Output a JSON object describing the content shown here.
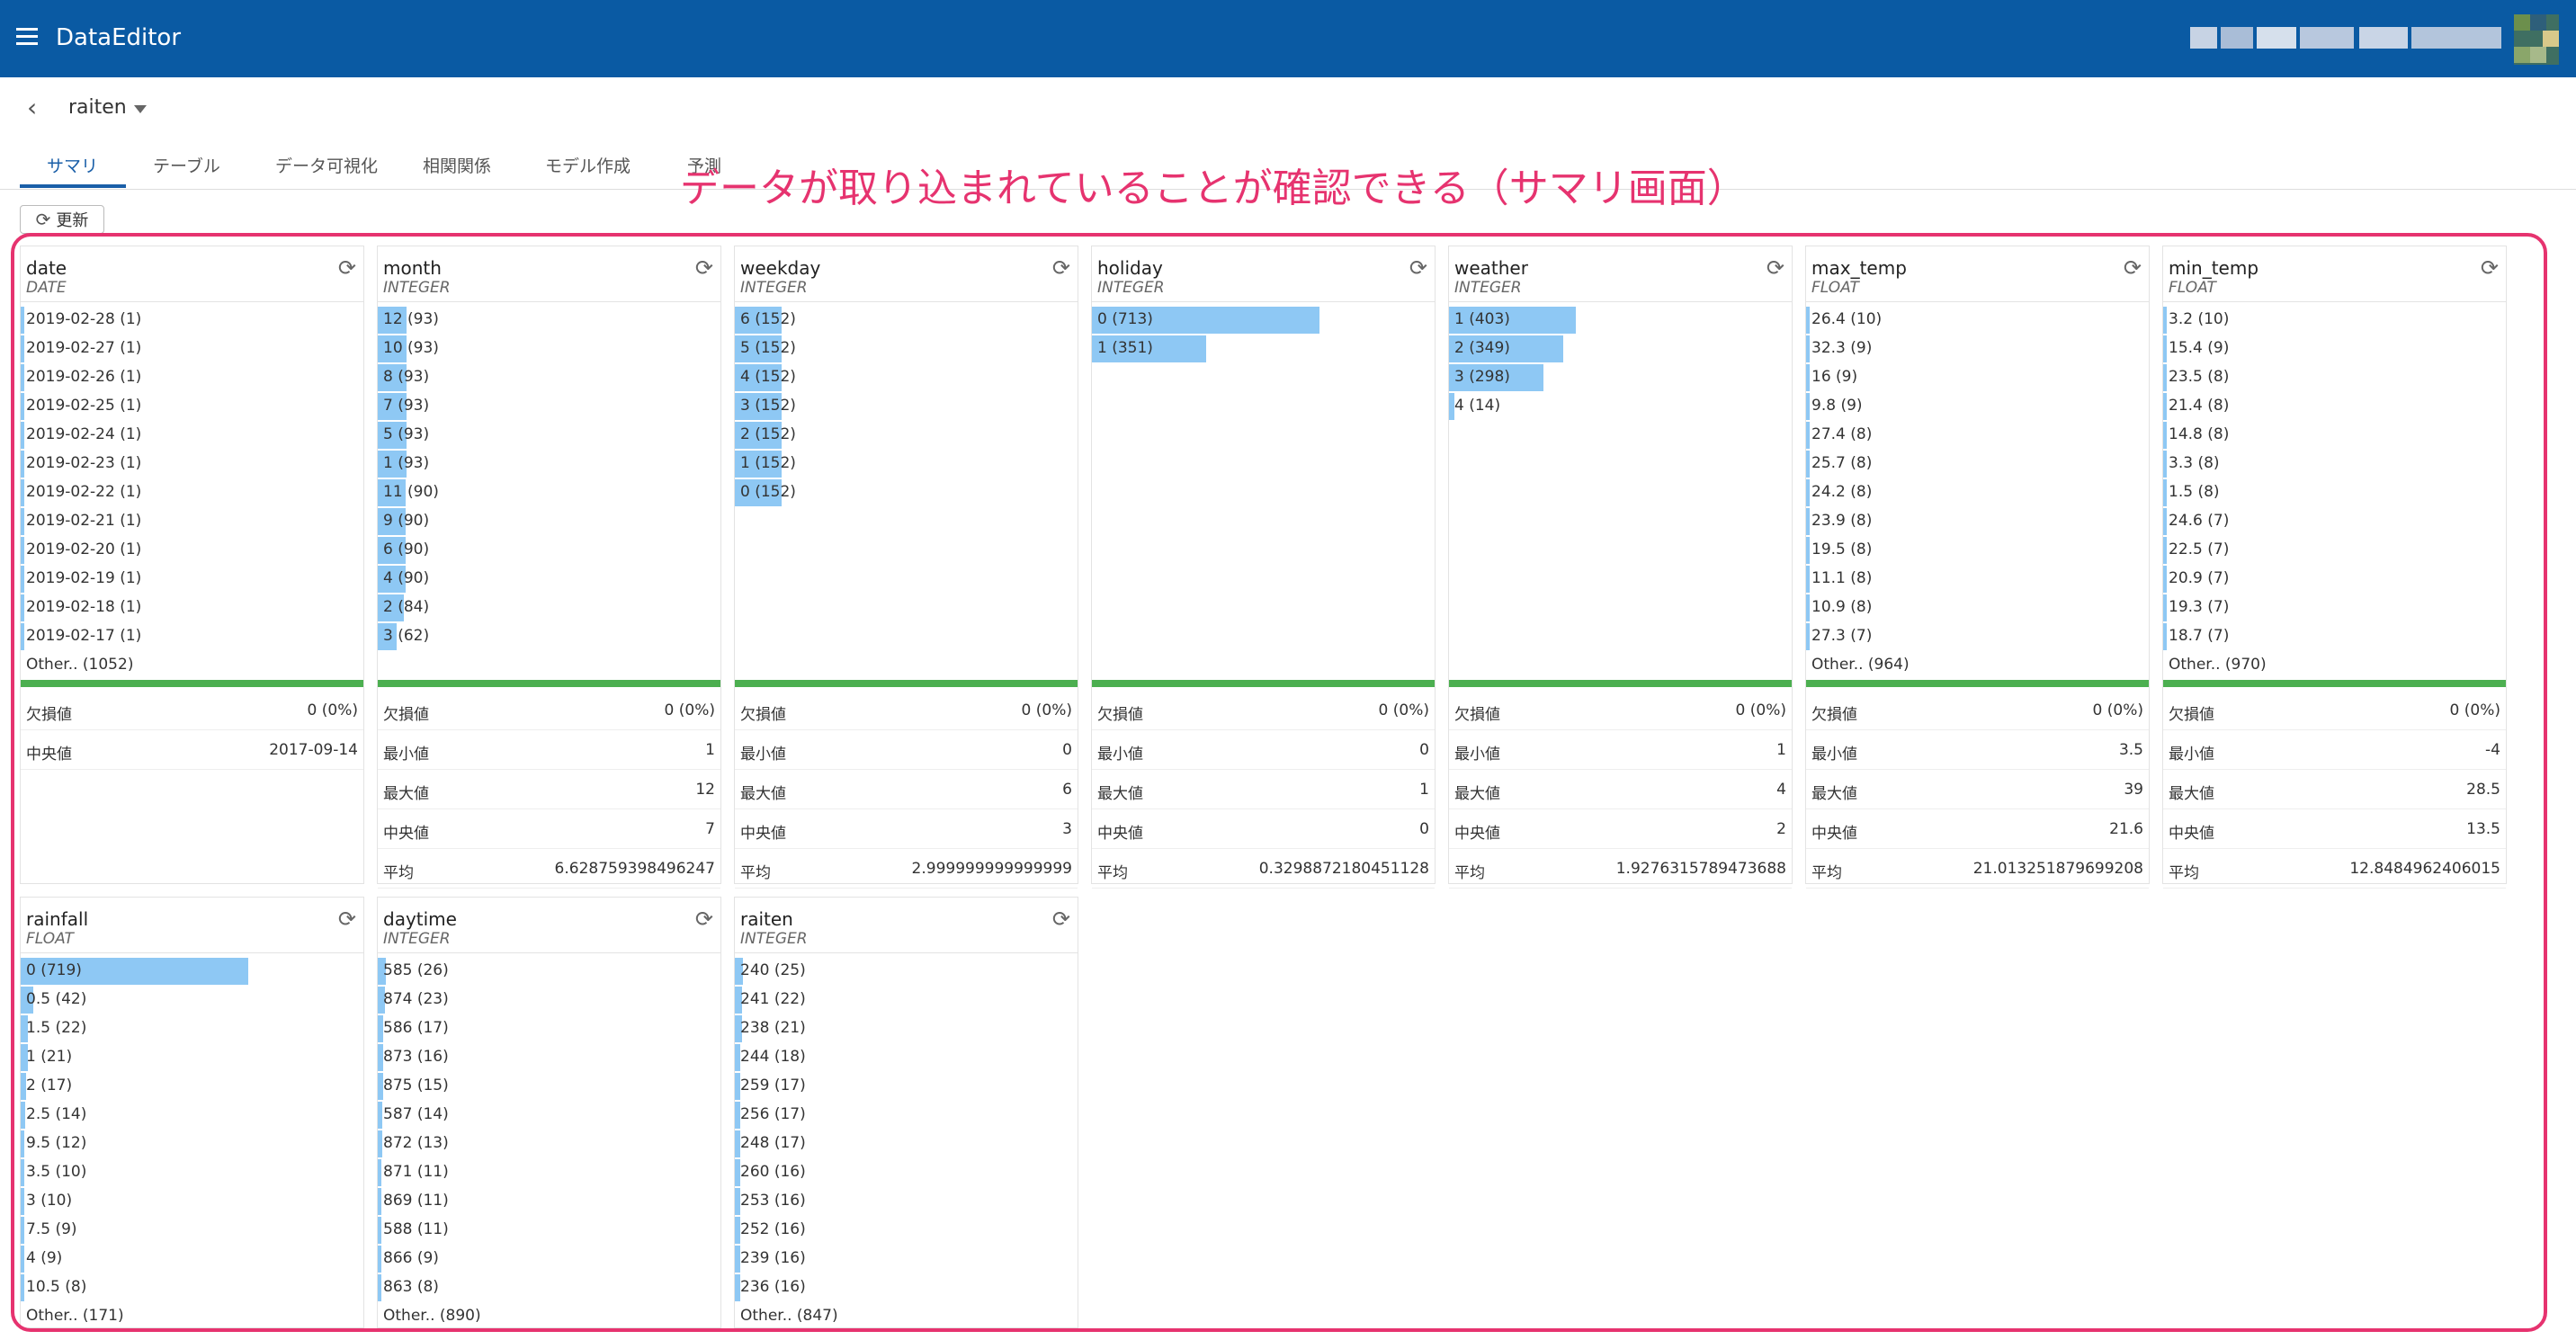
{
  "app": {
    "title": "DataEditor"
  },
  "breadcrumb": {
    "dataset": "raiten"
  },
  "tabs": [
    {
      "label": "サマリ",
      "active": true
    },
    {
      "label": "テーブル"
    },
    {
      "label": "データ可視化"
    },
    {
      "label": "相関関係"
    },
    {
      "label": "モデル作成"
    },
    {
      "label": "予測"
    }
  ],
  "toolbar": {
    "refresh_label": "更新"
  },
  "annotation": {
    "text": "データが取り込まれていることが確認できる（サマリ画面）"
  },
  "colors": {
    "header": "#0a5aa3",
    "bar": "#8ec8f4",
    "valid_line": "#4caf50",
    "annotation": "#e6336f"
  },
  "columns": [
    {
      "name": "date",
      "type": "DATE",
      "freq": [
        {
          "label": "2019-02-28 (1)",
          "ratio": 0.003
        },
        {
          "label": "2019-02-27 (1)",
          "ratio": 0.003
        },
        {
          "label": "2019-02-26 (1)",
          "ratio": 0.003
        },
        {
          "label": "2019-02-25 (1)",
          "ratio": 0.003
        },
        {
          "label": "2019-02-24 (1)",
          "ratio": 0.003
        },
        {
          "label": "2019-02-23 (1)",
          "ratio": 0.003
        },
        {
          "label": "2019-02-22 (1)",
          "ratio": 0.003
        },
        {
          "label": "2019-02-21 (1)",
          "ratio": 0.003
        },
        {
          "label": "2019-02-20 (1)",
          "ratio": 0.003
        },
        {
          "label": "2019-02-19 (1)",
          "ratio": 0.003
        },
        {
          "label": "2019-02-18 (1)",
          "ratio": 0.003
        },
        {
          "label": "2019-02-17 (1)",
          "ratio": 0.003
        }
      ],
      "other": "Other.. (1052)",
      "stats": [
        {
          "label": "欠損値",
          "value": "0 (0%)"
        },
        {
          "label": "中央値",
          "value": "2017-09-14"
        }
      ]
    },
    {
      "name": "month",
      "type": "INTEGER",
      "freq": [
        {
          "label": "12 (93)",
          "ratio": 0.045
        },
        {
          "label": "10 (93)",
          "ratio": 0.045
        },
        {
          "label": "8 (93)",
          "ratio": 0.045
        },
        {
          "label": "7 (93)",
          "ratio": 0.045
        },
        {
          "label": "5 (93)",
          "ratio": 0.045
        },
        {
          "label": "1 (93)",
          "ratio": 0.045
        },
        {
          "label": "11 (90)",
          "ratio": 0.044
        },
        {
          "label": "9 (90)",
          "ratio": 0.044
        },
        {
          "label": "6 (90)",
          "ratio": 0.044
        },
        {
          "label": "4 (90)",
          "ratio": 0.044
        },
        {
          "label": "2 (84)",
          "ratio": 0.041
        },
        {
          "label": "3 (62)",
          "ratio": 0.03
        }
      ],
      "other": "",
      "stats": [
        {
          "label": "欠損値",
          "value": "0 (0%)"
        },
        {
          "label": "最小値",
          "value": "1"
        },
        {
          "label": "最大値",
          "value": "12"
        },
        {
          "label": "中央値",
          "value": "7"
        },
        {
          "label": "平均",
          "value": "6.628759398496247"
        }
      ]
    },
    {
      "name": "weekday",
      "type": "INTEGER",
      "freq": [
        {
          "label": "6 (152)",
          "ratio": 0.074
        },
        {
          "label": "5 (152)",
          "ratio": 0.074
        },
        {
          "label": "4 (152)",
          "ratio": 0.074
        },
        {
          "label": "3 (152)",
          "ratio": 0.074
        },
        {
          "label": "2 (152)",
          "ratio": 0.074
        },
        {
          "label": "1 (152)",
          "ratio": 0.074
        },
        {
          "label": "0 (152)",
          "ratio": 0.074
        }
      ],
      "other": "",
      "stats": [
        {
          "label": "欠損値",
          "value": "0 (0%)"
        },
        {
          "label": "最小値",
          "value": "0"
        },
        {
          "label": "最大値",
          "value": "6"
        },
        {
          "label": "中央値",
          "value": "3"
        },
        {
          "label": "平均",
          "value": "2.999999999999999"
        }
      ]
    },
    {
      "name": "holiday",
      "type": "INTEGER",
      "freq": [
        {
          "label": "0 (713)",
          "ratio": 0.36
        },
        {
          "label": "1 (351)",
          "ratio": 0.18
        }
      ],
      "other": "",
      "stats": [
        {
          "label": "欠損値",
          "value": "0 (0%)"
        },
        {
          "label": "最小値",
          "value": "0"
        },
        {
          "label": "最大値",
          "value": "1"
        },
        {
          "label": "中央値",
          "value": "0"
        },
        {
          "label": "平均",
          "value": "0.3298872180451128"
        }
      ]
    },
    {
      "name": "weather",
      "type": "INTEGER",
      "freq": [
        {
          "label": "1 (403)",
          "ratio": 0.2
        },
        {
          "label": "2 (349)",
          "ratio": 0.18
        },
        {
          "label": "3 (298)",
          "ratio": 0.15
        },
        {
          "label": "4 (14)",
          "ratio": 0.008
        }
      ],
      "other": "",
      "stats": [
        {
          "label": "欠損値",
          "value": "0 (0%)"
        },
        {
          "label": "最小値",
          "value": "1"
        },
        {
          "label": "最大値",
          "value": "4"
        },
        {
          "label": "中央値",
          "value": "2"
        },
        {
          "label": "平均",
          "value": "1.9276315789473688"
        }
      ]
    },
    {
      "name": "max_temp",
      "type": "FLOAT",
      "freq": [
        {
          "label": "26.4 (10)",
          "ratio": 0.005
        },
        {
          "label": "32.3 (9)",
          "ratio": 0.005
        },
        {
          "label": "16 (9)",
          "ratio": 0.005
        },
        {
          "label": "9.8 (9)",
          "ratio": 0.005
        },
        {
          "label": "27.4 (8)",
          "ratio": 0.004
        },
        {
          "label": "25.7 (8)",
          "ratio": 0.004
        },
        {
          "label": "24.2 (8)",
          "ratio": 0.004
        },
        {
          "label": "23.9 (8)",
          "ratio": 0.004
        },
        {
          "label": "19.5 (8)",
          "ratio": 0.004
        },
        {
          "label": "11.1 (8)",
          "ratio": 0.004
        },
        {
          "label": "10.9 (8)",
          "ratio": 0.004
        },
        {
          "label": "27.3 (7)",
          "ratio": 0.004
        }
      ],
      "other": "Other.. (964)",
      "stats": [
        {
          "label": "欠損値",
          "value": "0 (0%)"
        },
        {
          "label": "最小値",
          "value": "3.5"
        },
        {
          "label": "最大値",
          "value": "39"
        },
        {
          "label": "中央値",
          "value": "21.6"
        },
        {
          "label": "平均",
          "value": "21.013251879699208"
        }
      ]
    },
    {
      "name": "min_temp",
      "type": "FLOAT",
      "freq": [
        {
          "label": "3.2 (10)",
          "ratio": 0.005
        },
        {
          "label": "15.4 (9)",
          "ratio": 0.005
        },
        {
          "label": "23.5 (8)",
          "ratio": 0.004
        },
        {
          "label": "21.4 (8)",
          "ratio": 0.004
        },
        {
          "label": "14.8 (8)",
          "ratio": 0.004
        },
        {
          "label": "3.3 (8)",
          "ratio": 0.004
        },
        {
          "label": "1.5 (8)",
          "ratio": 0.004
        },
        {
          "label": "24.6 (7)",
          "ratio": 0.004
        },
        {
          "label": "22.5 (7)",
          "ratio": 0.004
        },
        {
          "label": "20.9 (7)",
          "ratio": 0.004
        },
        {
          "label": "19.3 (7)",
          "ratio": 0.004
        },
        {
          "label": "18.7 (7)",
          "ratio": 0.004
        }
      ],
      "other": "Other.. (970)",
      "stats": [
        {
          "label": "欠損値",
          "value": "0 (0%)"
        },
        {
          "label": "最小値",
          "value": "-4"
        },
        {
          "label": "最大値",
          "value": "28.5"
        },
        {
          "label": "中央値",
          "value": "13.5"
        },
        {
          "label": "平均",
          "value": "12.8484962406015"
        }
      ]
    },
    {
      "name": "rainfall",
      "type": "FLOAT",
      "freq": [
        {
          "label": "0 (719)",
          "ratio": 0.36
        },
        {
          "label": "0.5 (42)",
          "ratio": 0.02
        },
        {
          "label": "1.5 (22)",
          "ratio": 0.011
        },
        {
          "label": "1 (21)",
          "ratio": 0.011
        },
        {
          "label": "2 (17)",
          "ratio": 0.009
        },
        {
          "label": "2.5 (14)",
          "ratio": 0.007
        },
        {
          "label": "9.5 (12)",
          "ratio": 0.006
        },
        {
          "label": "3.5 (10)",
          "ratio": 0.005
        },
        {
          "label": "3 (10)",
          "ratio": 0.005
        },
        {
          "label": "7.5 (9)",
          "ratio": 0.005
        },
        {
          "label": "4 (9)",
          "ratio": 0.005
        },
        {
          "label": "10.5 (8)",
          "ratio": 0.004
        }
      ],
      "other": "Other.. (171)",
      "stats": []
    },
    {
      "name": "daytime",
      "type": "INTEGER",
      "freq": [
        {
          "label": "585 (26)",
          "ratio": 0.013
        },
        {
          "label": "874 (23)",
          "ratio": 0.012
        },
        {
          "label": "586 (17)",
          "ratio": 0.009
        },
        {
          "label": "873 (16)",
          "ratio": 0.008
        },
        {
          "label": "875 (15)",
          "ratio": 0.008
        },
        {
          "label": "587 (14)",
          "ratio": 0.007
        },
        {
          "label": "872 (13)",
          "ratio": 0.007
        },
        {
          "label": "871 (11)",
          "ratio": 0.006
        },
        {
          "label": "869 (11)",
          "ratio": 0.006
        },
        {
          "label": "588 (11)",
          "ratio": 0.006
        },
        {
          "label": "866 (9)",
          "ratio": 0.005
        },
        {
          "label": "863 (8)",
          "ratio": 0.004
        }
      ],
      "other": "Other.. (890)",
      "stats": []
    },
    {
      "name": "raiten",
      "type": "INTEGER",
      "freq": [
        {
          "label": "240 (25)",
          "ratio": 0.013
        },
        {
          "label": "241 (22)",
          "ratio": 0.011
        },
        {
          "label": "238 (21)",
          "ratio": 0.011
        },
        {
          "label": "244 (18)",
          "ratio": 0.009
        },
        {
          "label": "259 (17)",
          "ratio": 0.009
        },
        {
          "label": "256 (17)",
          "ratio": 0.009
        },
        {
          "label": "248 (17)",
          "ratio": 0.009
        },
        {
          "label": "260 (16)",
          "ratio": 0.008
        },
        {
          "label": "253 (16)",
          "ratio": 0.008
        },
        {
          "label": "252 (16)",
          "ratio": 0.008
        },
        {
          "label": "239 (16)",
          "ratio": 0.008
        },
        {
          "label": "236 (16)",
          "ratio": 0.008
        }
      ],
      "other": "Other.. (847)",
      "stats": []
    }
  ]
}
